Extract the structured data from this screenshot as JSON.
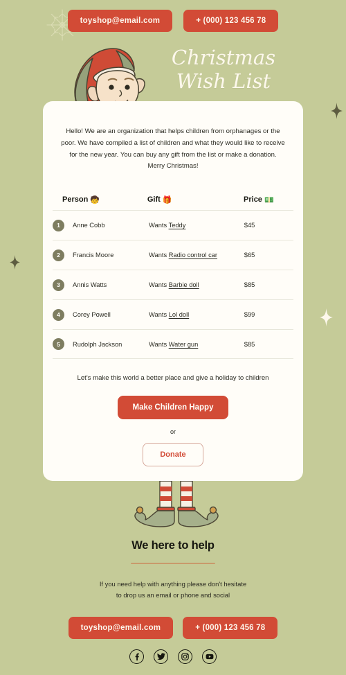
{
  "colors": {
    "background": "#c5cb98",
    "accent_red": "#d24b36",
    "card": "#fffdf8",
    "cream": "#fdf8ec",
    "badge": "#7e7d60",
    "rule": "#c99a6b",
    "text": "#2b2b22"
  },
  "header": {
    "email_button": "toyshop@email.com",
    "phone_button": "+ (000) 123 456 78",
    "title_line1": "Christmas",
    "title_line2": "Wish List",
    "snowflake_icon": "snowflake-icon",
    "elf_icon": "elf-character-illustration"
  },
  "card": {
    "intro": "Hello! We are an organization that helps children from orphanages or the poor. We have compiled a list of children and what they would like to receive for the new year. You can buy any gift from the list or make a donation. Merry Christmas!",
    "table": {
      "columns": [
        {
          "label": "Person",
          "emoji": "🧒"
        },
        {
          "label": "Gift",
          "emoji": "🎁"
        },
        {
          "label": "Price",
          "emoji": "💵"
        }
      ],
      "rows": [
        {
          "num": "1",
          "person": "Anne Cobb",
          "wants": "Wants",
          "gift": "Teddy",
          "price": "$45"
        },
        {
          "num": "2",
          "person": "Francis Moore",
          "wants": "Wants",
          "gift": "Radio control car",
          "price": "$65"
        },
        {
          "num": "3",
          "person": "Annis Watts",
          "wants": "Wants",
          "gift": "Barbie doll",
          "price": "$85"
        },
        {
          "num": "4",
          "person": "Corey Powell",
          "wants": "Wants",
          "gift": "Lol doll",
          "price": "$99"
        },
        {
          "num": "5",
          "person": "Rudolph Jackson",
          "wants": "Wants",
          "gift": "Water gun",
          "price": "$85"
        }
      ]
    },
    "cta_text": "Let's make this world a better place and give a holiday to children",
    "primary_button": "Make Children Happy",
    "or_label": "or",
    "secondary_button": "Donate"
  },
  "footer": {
    "title": "We here to help",
    "text_line1": "If you need help with anything please don't hesitate",
    "text_line2": "to drop us an email or phone and social",
    "email_button": "toyshop@email.com",
    "phone_button": "+ (000) 123 456 78",
    "socials": [
      {
        "name": "facebook-icon"
      },
      {
        "name": "twitter-icon"
      },
      {
        "name": "instagram-icon"
      },
      {
        "name": "youtube-icon"
      }
    ],
    "legs_icon": "elf-legs-illustration"
  },
  "decorations": {
    "sparkle_icon": "sparkle-star-icon"
  }
}
